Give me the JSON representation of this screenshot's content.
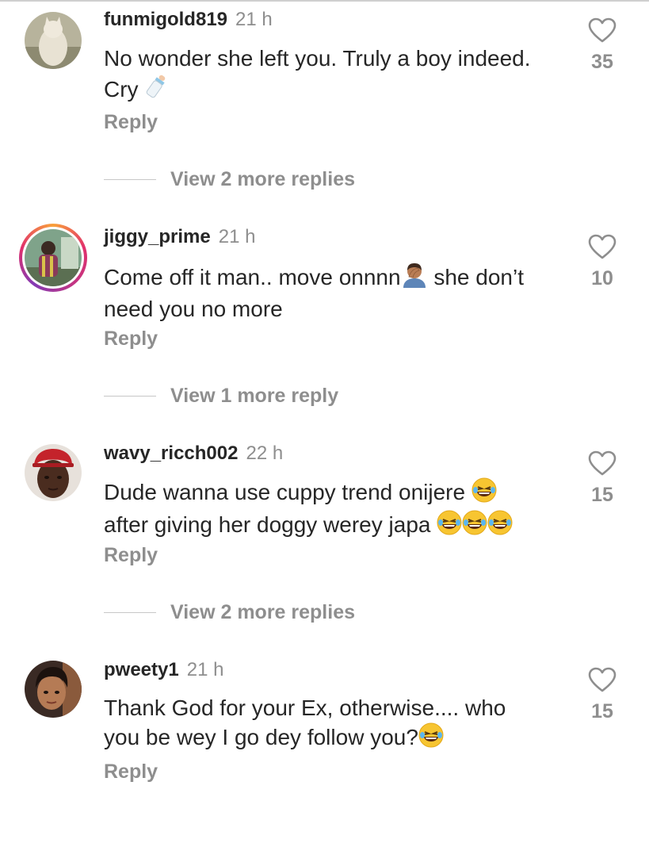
{
  "comments": [
    {
      "username": "funmigold819",
      "time": "21 h",
      "text_line1": "No wonder she left you. Truly a boy indeed.",
      "text_line2": "Cry",
      "text_emoji": "baby-bottle",
      "reply_label": "Reply",
      "likes": "35",
      "view_replies": "View 2 more replies",
      "avatar": "cat-photo",
      "has_story_ring": false
    },
    {
      "username": "jiggy_prime",
      "time": "21 h",
      "text_line1_a": "Come off it man.. move onnnn",
      "text_line1_emoji": "person-facepalming",
      "text_line1_b": " she don’t",
      "text_line2": "need you no more",
      "reply_label": "Reply",
      "likes": "10",
      "view_replies": "View 1 more reply",
      "avatar": "person-photo",
      "has_story_ring": true
    },
    {
      "username": "wavy_ricch002",
      "time": "22 h",
      "text_line1": "Dude wanna use cuppy trend onijere",
      "text_line1_emoji": "laughing-emoji",
      "text_line2": "after giving her doggy werey japa",
      "text_line2_emoji": "laughing-emoji-x3",
      "reply_label": "Reply",
      "likes": "15",
      "view_replies": "View 2 more replies",
      "avatar": "man-red-cap-photo",
      "has_story_ring": false
    },
    {
      "username": "pweety1",
      "time": "21 h",
      "text_line1": "Thank God for your Ex, otherwise.... who",
      "text_line2": "you be wey I go dey follow you?",
      "text_line2_emoji": "laughing-emoji",
      "reply_label": "Reply",
      "likes": "15",
      "avatar": "woman-photo",
      "has_story_ring": false
    }
  ],
  "colors": {
    "text": "#262626",
    "muted": "#8e8e8e",
    "story_ring": [
      "#f9a13a",
      "#e1306c",
      "#833ab4"
    ]
  }
}
